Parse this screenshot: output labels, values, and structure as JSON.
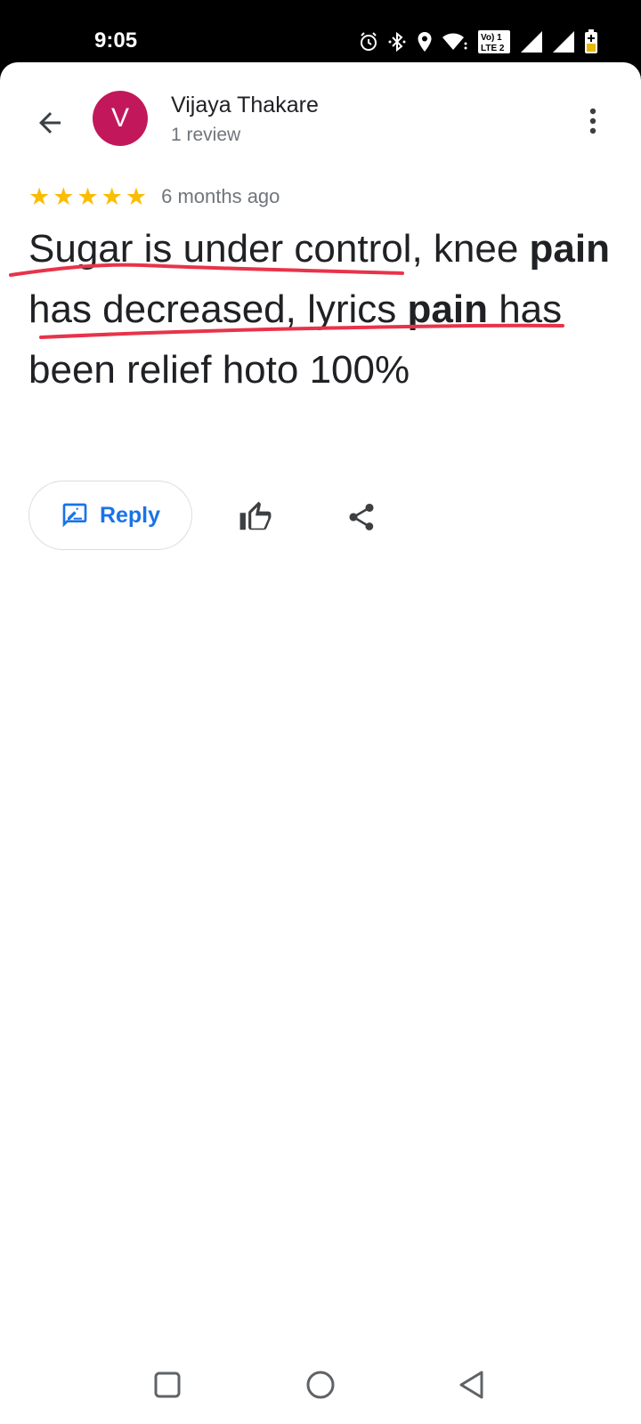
{
  "status_bar": {
    "time": "9:05",
    "icons": [
      "alarm-icon",
      "bluetooth-icon",
      "location-icon",
      "wifi-icon",
      "volte-icon",
      "signal-icon",
      "signal-icon",
      "battery-icon"
    ],
    "volte_label": "Vo) 1\nLTE 2"
  },
  "header": {
    "back_icon": "arrow-back-icon",
    "avatar_letter": "V",
    "avatar_color": "#c2185b",
    "reviewer_name": "Vijaya Thakare",
    "review_count": "1 review",
    "more_icon": "more-vert-icon"
  },
  "review": {
    "rating": 5,
    "max_rating": 5,
    "star_glyph": "★",
    "star_color": "#fbbc04",
    "time_ago": "6 months ago",
    "text_segments": [
      {
        "text": "Sugar is under control, knee ",
        "bold": false
      },
      {
        "text": "pain",
        "bold": true
      },
      {
        "text": " has decreased, lyrics ",
        "bold": false
      },
      {
        "text": "pain",
        "bold": true
      },
      {
        "text": " has been relief hoto 100%",
        "bold": false
      }
    ],
    "annotation_color": "#e8334a"
  },
  "actions": {
    "reply_label": "Reply",
    "reply_icon": "rate-review-icon",
    "like_icon": "thumb-up-icon",
    "share_icon": "share-icon",
    "accent_color": "#1a73e8"
  },
  "nav_bar": {
    "icons": [
      "recents-square-icon",
      "home-circle-icon",
      "back-triangle-icon"
    ]
  }
}
